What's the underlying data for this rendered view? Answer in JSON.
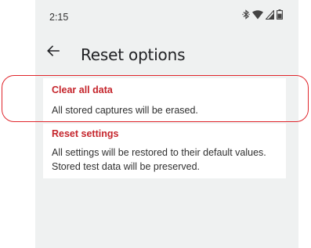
{
  "status_bar": {
    "time": "2:15",
    "icons": [
      "bluetooth-icon",
      "wifi-icon",
      "signal-icon",
      "battery-icon"
    ]
  },
  "app_bar": {
    "back_icon": "arrow-back-icon",
    "title": "Reset options"
  },
  "options": [
    {
      "title": "Clear all data",
      "description": "All stored captures will be erased."
    },
    {
      "title": "Reset settings",
      "description": "All settings will be restored to their default values. Stored test data will be preserved."
    }
  ],
  "colors": {
    "accent": "#c5252c",
    "highlight": "#e0262c",
    "background": "#eff1f1"
  }
}
